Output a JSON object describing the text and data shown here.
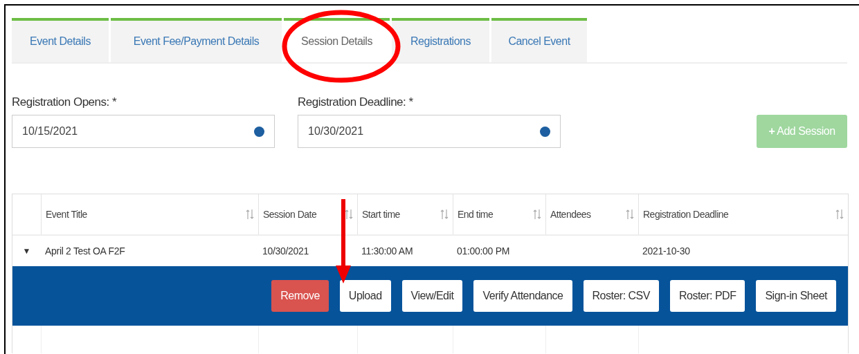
{
  "tabs": [
    {
      "label": "Event Details",
      "selected": false
    },
    {
      "label": "Event Fee/Payment Details",
      "selected": false
    },
    {
      "label": "Session Details",
      "selected": true
    },
    {
      "label": "Registrations",
      "selected": false
    },
    {
      "label": "Cancel Event",
      "selected": false
    }
  ],
  "form": {
    "fields": [
      {
        "label": "Registration Opens: *",
        "value": "10/15/2021"
      },
      {
        "label": "Registration Deadline: *",
        "value": "10/30/2021"
      }
    ],
    "add_button": {
      "icon": "+",
      "label": "Add Session",
      "disabled": true
    }
  },
  "table": {
    "columns": [
      "Event Title",
      "Session Date",
      "Start time",
      "End time",
      "Attendees",
      "Registration Deadline"
    ],
    "rows": [
      {
        "expanded": true,
        "toggle": "▼",
        "cells": [
          "April 2 Test OA F2F",
          "10/30/2021",
          "11:30:00 AM",
          "01:00:00 PM",
          "",
          "2021-10-30"
        ],
        "actions": [
          {
            "label": "Remove",
            "kind": "danger"
          },
          {
            "label": "Upload",
            "kind": "plain"
          },
          {
            "label": "View/Edit",
            "kind": "plain"
          },
          {
            "label": "Verify Attendance",
            "kind": "plain"
          },
          {
            "label": "Roster: CSV",
            "kind": "plain"
          },
          {
            "label": "Roster: PDF",
            "kind": "plain"
          },
          {
            "label": "Sign-in Sheet",
            "kind": "plain"
          }
        ]
      }
    ]
  }
}
